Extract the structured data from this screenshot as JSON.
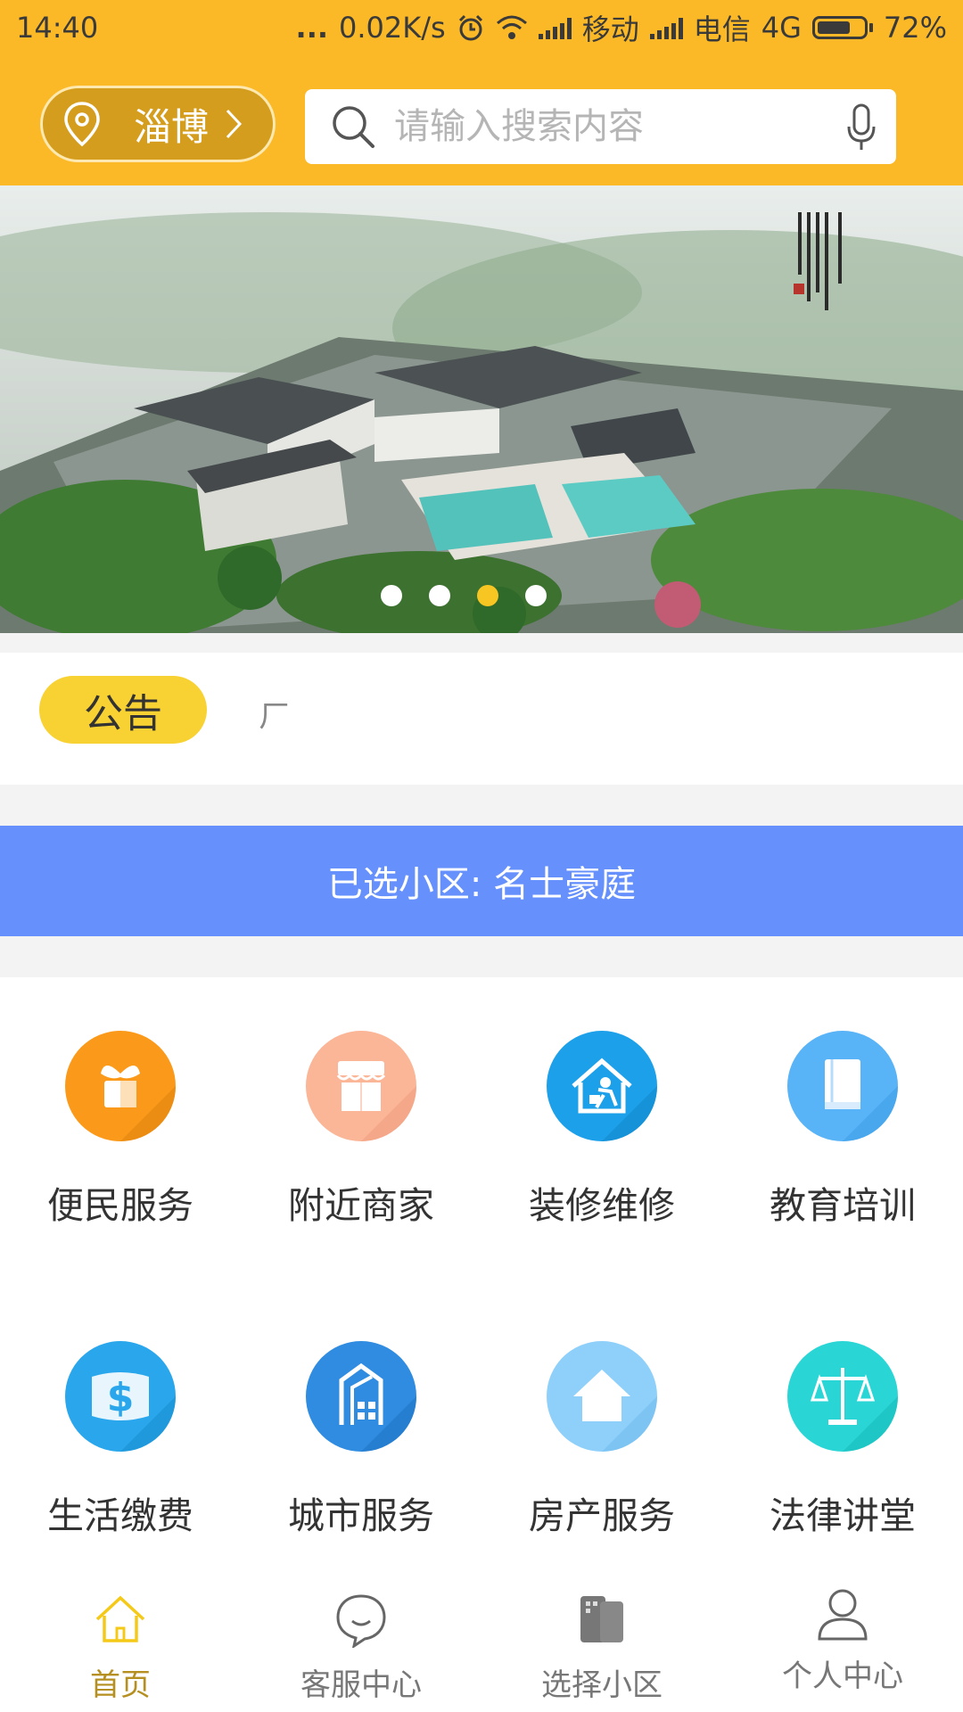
{
  "status_bar": {
    "time": "14:40",
    "dots": "...",
    "net_speed": "0.02K/s",
    "carrier1": "移动",
    "carrier2": "电信",
    "network": "4G",
    "battery": "72%",
    "battery_level": 0.72
  },
  "header": {
    "city": "淄博",
    "search_placeholder": "请输入搜索内容"
  },
  "banner": {
    "slide_count": 4,
    "active_slide": 3
  },
  "notice": {
    "badge": "公告",
    "text": "ㄏ"
  },
  "community": {
    "label": "已选小区: 名士豪庭"
  },
  "services": [
    {
      "label": "便民服务",
      "icon": "sprout-icon",
      "color": "#fb9a1a"
    },
    {
      "label": "附近商家",
      "icon": "shop-icon",
      "color": "#fbb597"
    },
    {
      "label": "装修维修",
      "icon": "repair-icon",
      "color": "#1da0ea"
    },
    {
      "label": "教育培训",
      "icon": "book-icon",
      "color": "#59b3f7"
    },
    {
      "label": "生活缴费",
      "icon": "payment-icon",
      "color": "#2aa7ec"
    },
    {
      "label": "城市服务",
      "icon": "building-icon",
      "color": "#2f8ce0"
    },
    {
      "label": "房产服务",
      "icon": "house-icon",
      "color": "#8fd0fb"
    },
    {
      "label": "法律讲堂",
      "icon": "scales-icon",
      "color": "#2ad6d5"
    }
  ],
  "tabs": [
    {
      "label": "首页",
      "icon": "home-icon",
      "active": true
    },
    {
      "label": "客服中心",
      "icon": "chat-icon",
      "active": false
    },
    {
      "label": "选择小区",
      "icon": "community-icon",
      "active": false
    },
    {
      "label": "个人中心",
      "icon": "user-icon",
      "active": false
    }
  ]
}
